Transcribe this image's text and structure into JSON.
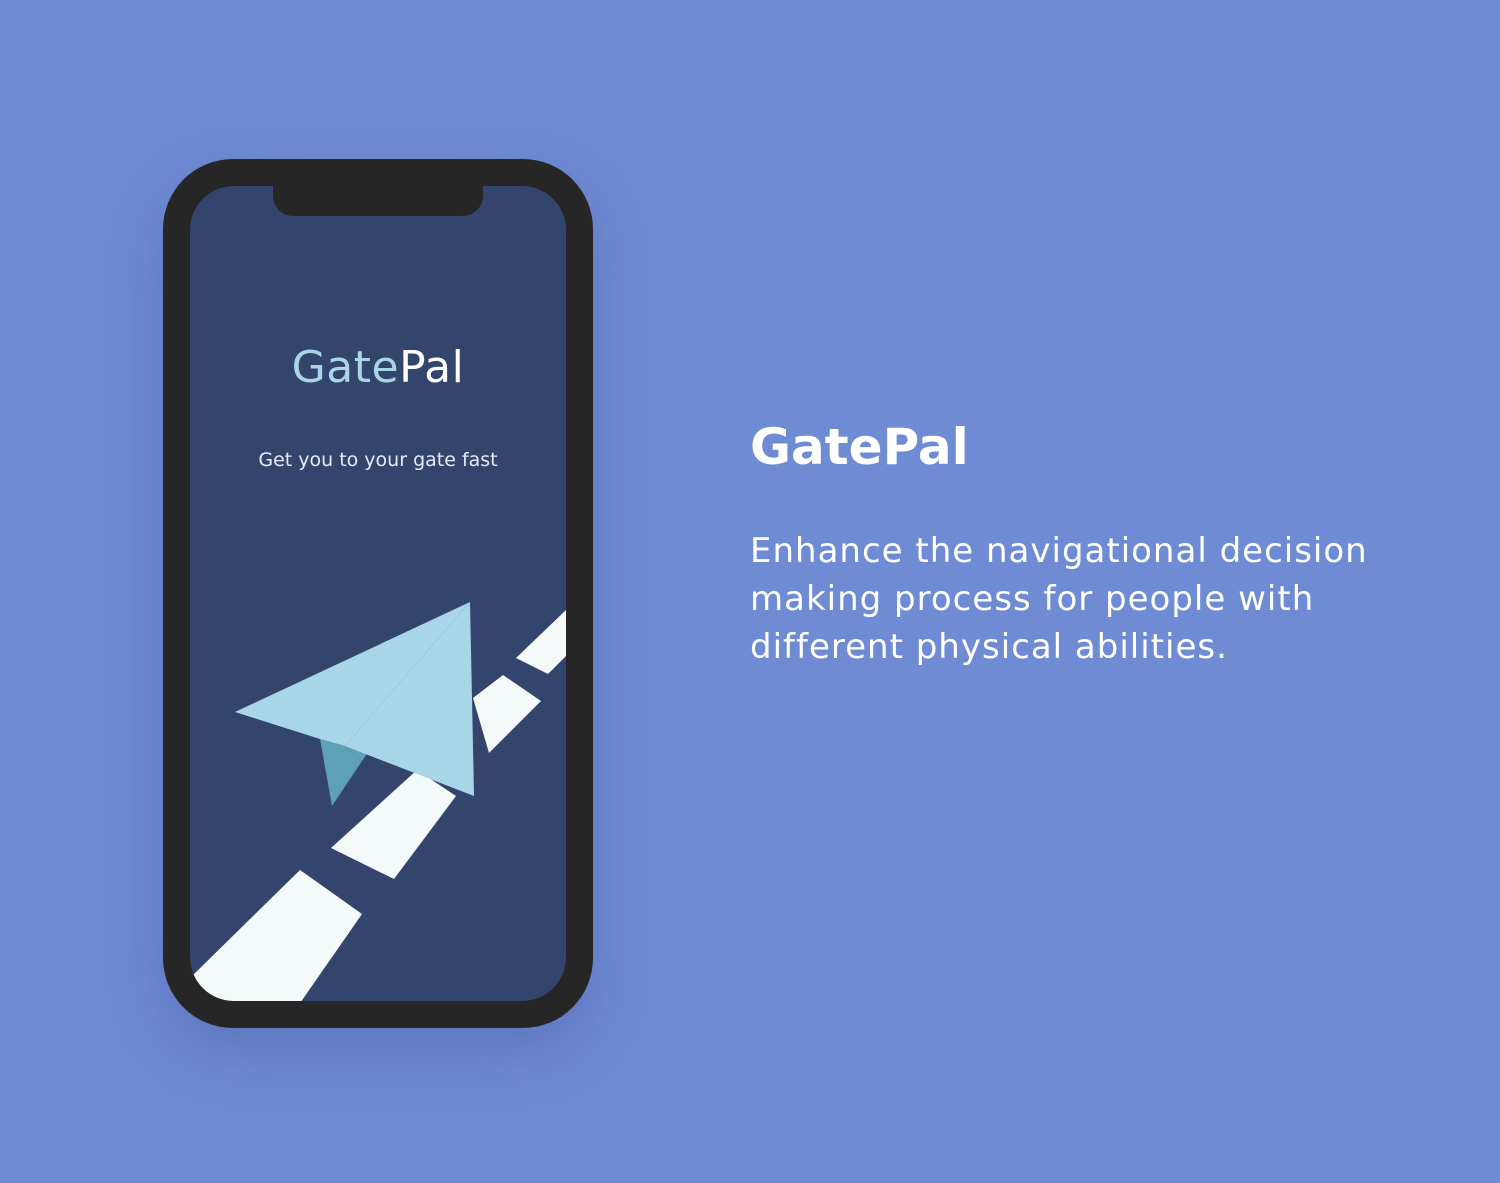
{
  "background_color": "#6f8bd4",
  "phone": {
    "frame_color": "#262626",
    "screen_color": "#34456d",
    "app_logo": {
      "part_1": "Gate",
      "part_2": "Pal",
      "part_1_color": "#a9d6e6",
      "part_2_color": "#ffffff"
    },
    "tagline": "Get you to your gate fast",
    "illustration": {
      "runway_icon": "runway-stripes",
      "plane_icon": "paper-plane"
    }
  },
  "headline": "GatePal",
  "description": "Enhance the navigational decision making process for people with different physical abilities."
}
